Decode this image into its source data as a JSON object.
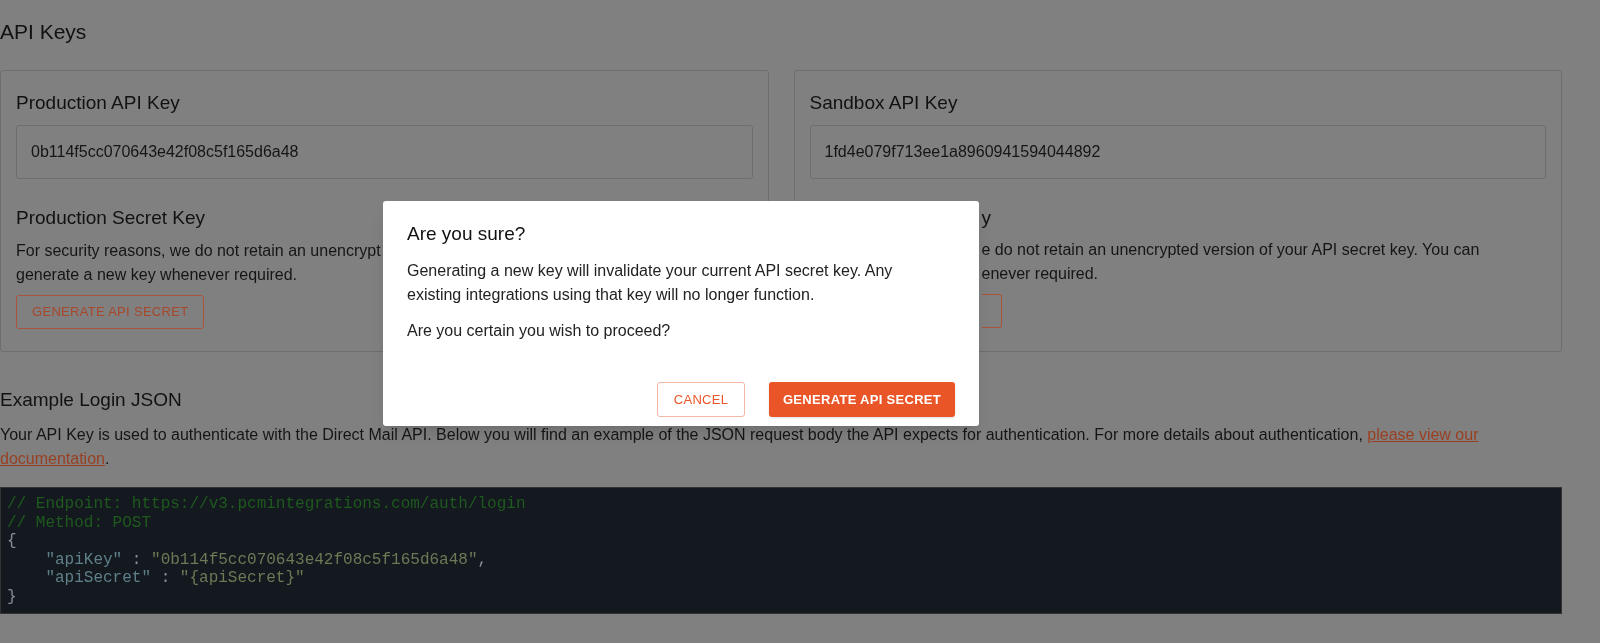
{
  "page_title": "API Keys",
  "cards": [
    {
      "title": "Production API Key",
      "key_value": "0b114f5cc070643e42f08c5f165d6a48",
      "secret_title": "Production Secret Key",
      "secret_lines": [
        "For security reasons, we do not retain an unencrypt",
        "generate a new key whenever required."
      ],
      "button": "GENERATE API SECRET",
      "kind": "full"
    },
    {
      "title": "Sandbox API Key",
      "key_value": "1fd4e079f713ee1a8960941594044892",
      "secret_title": "y",
      "secret_lines": [
        "e do not retain an unencrypted version of your API secret key. You can",
        "enever required."
      ],
      "kind": "partly_hidden"
    }
  ],
  "example": {
    "title": "Example Login JSON",
    "text": "Your API Key is used to authenticate with the Direct Mail API. Below you will find an example of the JSON request body the API expects for authentication. For more details about authentication,",
    "links": [
      "please view our",
      "documentation"
    ],
    "after": ".",
    "code_lines": [
      [
        {
          "kind": "comment",
          "text": "// Endpoint: https://v3.pcmintegrations.com/auth/login"
        }
      ],
      [
        {
          "kind": "comment",
          "text": "// Method: POST"
        }
      ],
      [
        {
          "kind": "punct",
          "text": "{"
        }
      ],
      [
        {
          "kind": "key",
          "text": "    \"apiKey\""
        },
        {
          "kind": "punct",
          "text": " : "
        },
        {
          "kind": "string",
          "text": "\"0b114f5cc070643e42f08c5f165d6a48\""
        },
        {
          "kind": "punct",
          "text": ","
        }
      ],
      [
        {
          "kind": "key",
          "text": "    \"apiSecret\""
        },
        {
          "kind": "punct",
          "text": " : "
        },
        {
          "kind": "string",
          "text": "\"{apiSecret}\""
        }
      ],
      [
        {
          "kind": "punct",
          "text": "}"
        }
      ]
    ]
  },
  "dialog": {
    "title": "Are you sure?",
    "paragraphs": [
      "Generating a new key will invalidate your current API secret key. Any existing integrations using that key will no longer function.",
      "Are you certain you wish to proceed?"
    ],
    "cancel": "CANCEL",
    "confirm": "GENERATE API SECRET"
  }
}
